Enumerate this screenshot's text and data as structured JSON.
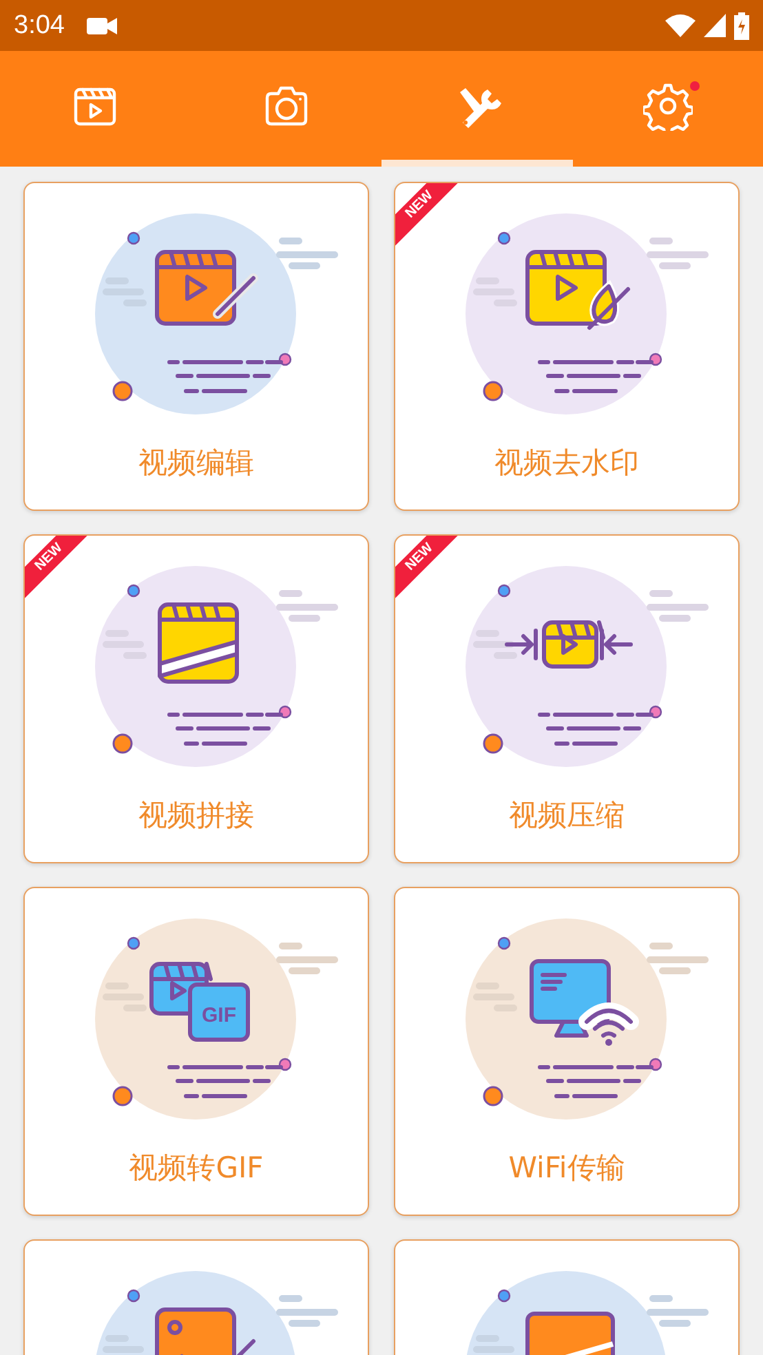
{
  "status_bar": {
    "time": "3:04"
  },
  "tabs": [
    {
      "kind": "clapper",
      "selected": false,
      "badge": false
    },
    {
      "kind": "camera",
      "selected": false,
      "badge": false
    },
    {
      "kind": "tools",
      "selected": true,
      "badge": false
    },
    {
      "kind": "gear",
      "selected": false,
      "badge": true
    }
  ],
  "tools": [
    {
      "kind": "edit",
      "color": "#d6e4f5",
      "label": "视频编辑"
    },
    {
      "kind": "watermark",
      "color": "#ede5f5",
      "label": "视频去水印",
      "ribbon": "NEW"
    },
    {
      "kind": "merge",
      "color": "#ede5f5",
      "label": "视频拼接",
      "ribbon": "NEW"
    },
    {
      "kind": "compress",
      "color": "#ede5f5",
      "label": "视频压缩",
      "ribbon": "NEW"
    },
    {
      "kind": "gif",
      "color": "#f5e6d8",
      "label": "视频转GIF",
      "icon_text": "GIF"
    },
    {
      "kind": "wifi",
      "color": "#f5e6d8",
      "label": "WiFi传输"
    },
    {
      "kind": "photo",
      "color": "#d6e4f5"
    },
    {
      "kind": "screen",
      "color": "#d6e4f5"
    }
  ]
}
